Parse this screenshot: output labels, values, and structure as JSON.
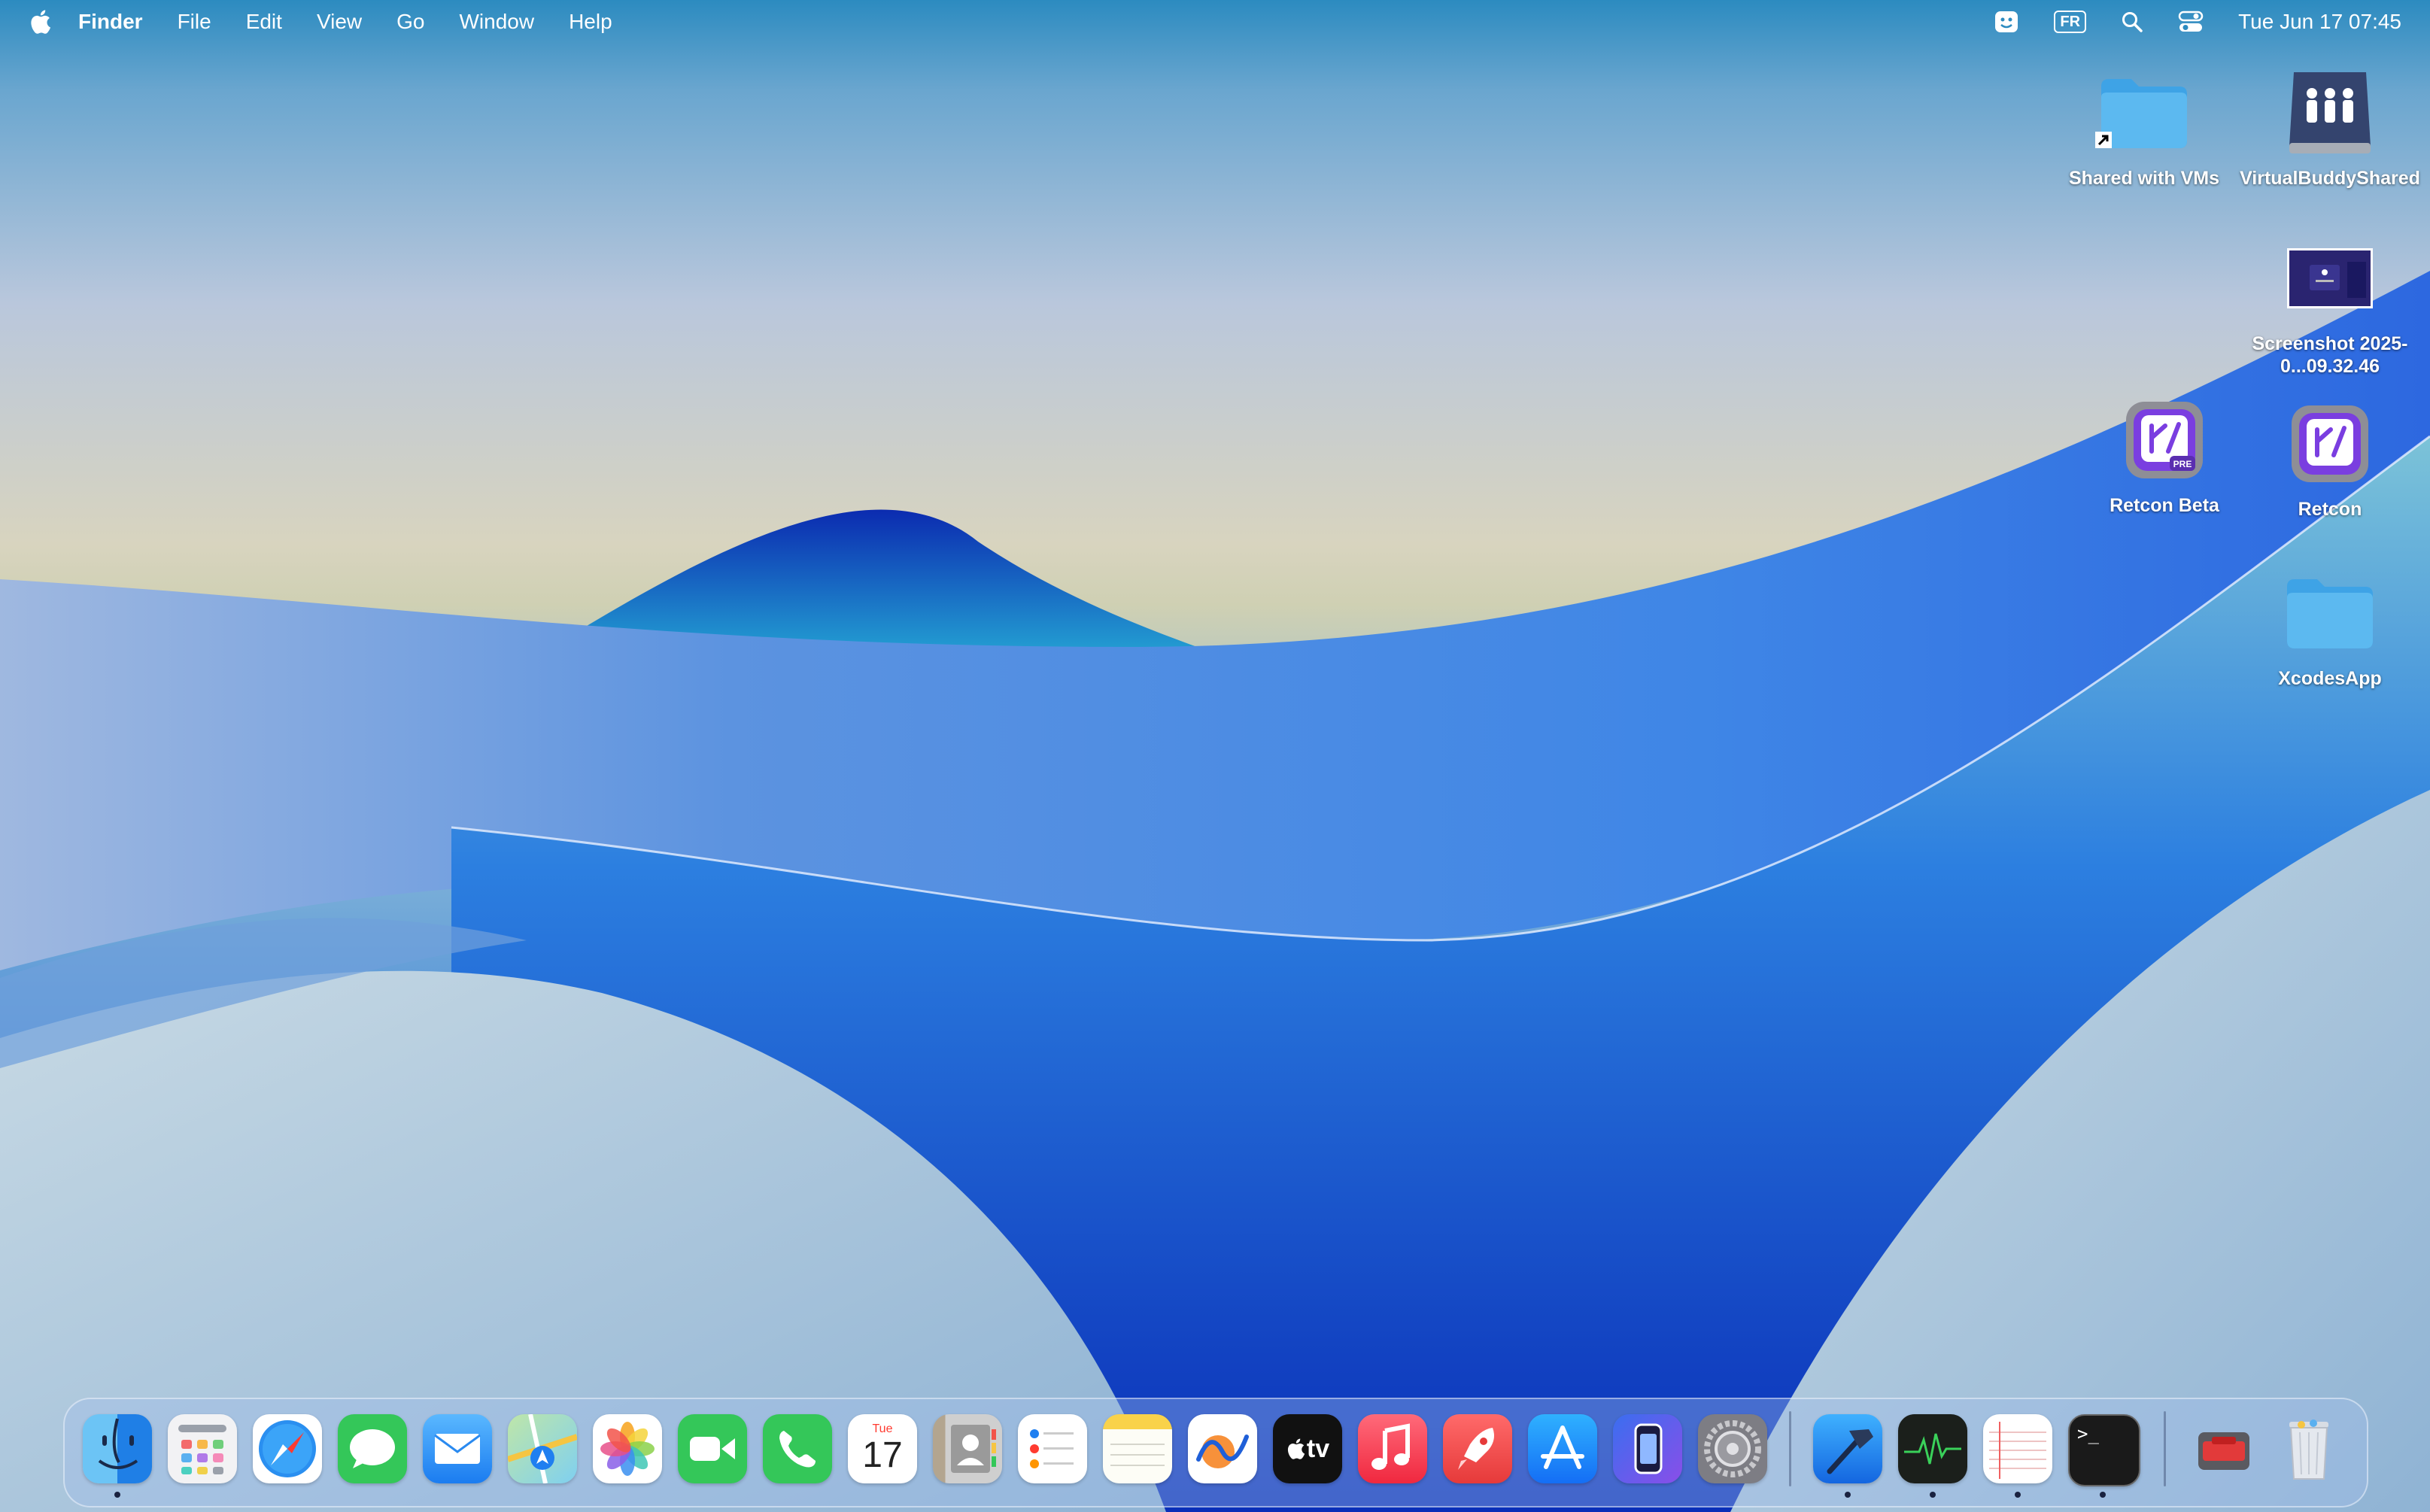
{
  "menubar": {
    "apple_icon": "apple-logo-icon",
    "app_name": "Finder",
    "menus": [
      "File",
      "Edit",
      "View",
      "Go",
      "Window",
      "Help"
    ],
    "status_icons": [
      "face-status-icon",
      "input-source-icon",
      "spotlight-search-icon",
      "control-center-icon"
    ],
    "input_source": "FR",
    "clock": "Tue Jun 17  07:45"
  },
  "desktop_icons": [
    {
      "label": "Shared with VMs",
      "icon": "folder-alias-icon"
    },
    {
      "label": "VirtualBuddyShared",
      "icon": "shared-drive-icon"
    },
    {
      "label": "Screenshot 2025-0...09.32.46",
      "icon": "screenshot-thumbnail-icon"
    },
    {
      "label": "Retcon Beta",
      "icon": "retcon-beta-app-icon"
    },
    {
      "label": "Retcon",
      "icon": "retcon-app-icon"
    },
    {
      "label": "XcodesApp",
      "icon": "folder-icon"
    }
  ],
  "dock": {
    "apps": [
      {
        "name": "Finder",
        "icon": "finder-icon",
        "running": true
      },
      {
        "name": "Launchpad",
        "icon": "launchpad-icon",
        "running": false
      },
      {
        "name": "Safari",
        "icon": "safari-icon",
        "running": false
      },
      {
        "name": "Messages",
        "icon": "messages-icon",
        "running": false
      },
      {
        "name": "Mail",
        "icon": "mail-icon",
        "running": false
      },
      {
        "name": "Maps",
        "icon": "maps-icon",
        "running": false
      },
      {
        "name": "Photos",
        "icon": "photos-icon",
        "running": false
      },
      {
        "name": "FaceTime",
        "icon": "facetime-icon",
        "running": false
      },
      {
        "name": "Phone",
        "icon": "phone-icon",
        "running": false
      },
      {
        "name": "Calendar",
        "icon": "calendar-icon",
        "running": false,
        "day": "Tue",
        "date": "17"
      },
      {
        "name": "Contacts",
        "icon": "contacts-icon",
        "running": false
      },
      {
        "name": "Reminders",
        "icon": "reminders-icon",
        "running": false
      },
      {
        "name": "Notes",
        "icon": "notes-icon",
        "running": false
      },
      {
        "name": "Freeform",
        "icon": "freeform-icon",
        "running": false
      },
      {
        "name": "TV",
        "icon": "apple-tv-icon",
        "running": false,
        "text": "tv"
      },
      {
        "name": "Music",
        "icon": "music-icon",
        "running": false
      },
      {
        "name": "Rocket",
        "icon": "rocket-icon",
        "running": false
      },
      {
        "name": "App Store",
        "icon": "app-store-icon",
        "running": false
      },
      {
        "name": "iPhone Mirroring",
        "icon": "iphone-mirroring-icon",
        "running": false
      },
      {
        "name": "System Settings",
        "icon": "system-settings-icon",
        "running": false
      },
      {
        "name": "Xcode",
        "icon": "xcode-hammer-icon",
        "running": true
      },
      {
        "name": "Activity Monitor",
        "icon": "activity-monitor-icon",
        "running": true
      },
      {
        "name": "TextEdit",
        "icon": "textedit-icon",
        "running": true
      },
      {
        "name": "Terminal",
        "icon": "terminal-icon",
        "running": true,
        "text": ">_"
      },
      {
        "name": "Tool",
        "icon": "red-toolbox-icon",
        "running": false
      },
      {
        "name": "Trash",
        "icon": "trash-icon",
        "running": false
      }
    ]
  },
  "colors": {
    "menubar_text": "#ffffff",
    "folder_blue": "#4db1ec",
    "retcon_purple": "#7a3ee0"
  }
}
